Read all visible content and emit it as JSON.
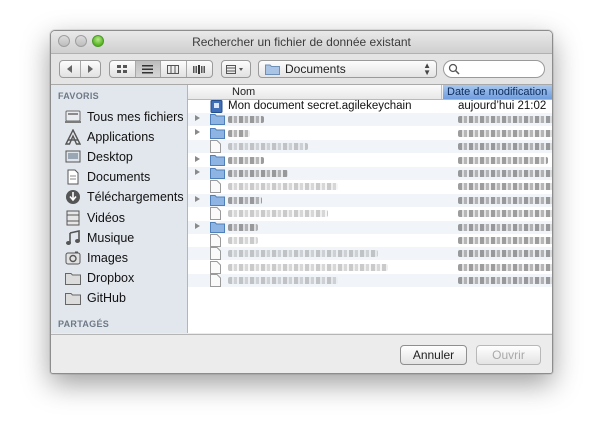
{
  "window": {
    "title": "Rechercher un fichier de donnée existant"
  },
  "toolbar": {
    "location": "Documents",
    "search_value": ""
  },
  "sidebar": {
    "favorites_heading": "FAVORIS",
    "shared_heading": "PARTAGÉS",
    "items": [
      {
        "label": "Tous mes fichiers",
        "icon": "all-files-icon"
      },
      {
        "label": "Applications",
        "icon": "applications-icon"
      },
      {
        "label": "Desktop",
        "icon": "desktop-icon"
      },
      {
        "label": "Documents",
        "icon": "documents-icon"
      },
      {
        "label": "Téléchargements",
        "icon": "downloads-icon"
      },
      {
        "label": "Vidéos",
        "icon": "movies-icon"
      },
      {
        "label": "Musique",
        "icon": "music-icon"
      },
      {
        "label": "Images",
        "icon": "pictures-icon"
      },
      {
        "label": "Dropbox",
        "icon": "folder-icon"
      },
      {
        "label": "GitHub",
        "icon": "folder-icon"
      }
    ]
  },
  "table": {
    "columns": [
      "Nom",
      "Date de modification"
    ],
    "rows": [
      {
        "name": "Mon document secret.agilekeychain",
        "date": "aujourd’hui 21:02",
        "kind": "keychain",
        "expandable": false
      },
      {
        "name": "",
        "date": "",
        "kind": "folder",
        "expandable": true
      },
      {
        "name": "",
        "date": "",
        "kind": "folder",
        "expandable": true
      },
      {
        "name": "",
        "date": "",
        "kind": "file",
        "expandable": false
      },
      {
        "name": "",
        "date": "",
        "kind": "folder",
        "expandable": true
      },
      {
        "name": "",
        "date": "",
        "kind": "folder",
        "expandable": true
      },
      {
        "name": "",
        "date": "",
        "kind": "file",
        "expandable": false
      },
      {
        "name": "",
        "date": "",
        "kind": "folder",
        "expandable": true
      },
      {
        "name": "",
        "date": "",
        "kind": "file",
        "expandable": false
      },
      {
        "name": "",
        "date": "",
        "kind": "folder",
        "expandable": true
      },
      {
        "name": "",
        "date": "",
        "kind": "file",
        "expandable": false
      },
      {
        "name": "",
        "date": "",
        "kind": "file",
        "expandable": false
      },
      {
        "name": "",
        "date": "",
        "kind": "file",
        "expandable": false
      },
      {
        "name": "",
        "date": "",
        "kind": "file",
        "expandable": false
      }
    ]
  },
  "footer": {
    "cancel_label": "Annuler",
    "open_label": "Ouvrir"
  }
}
